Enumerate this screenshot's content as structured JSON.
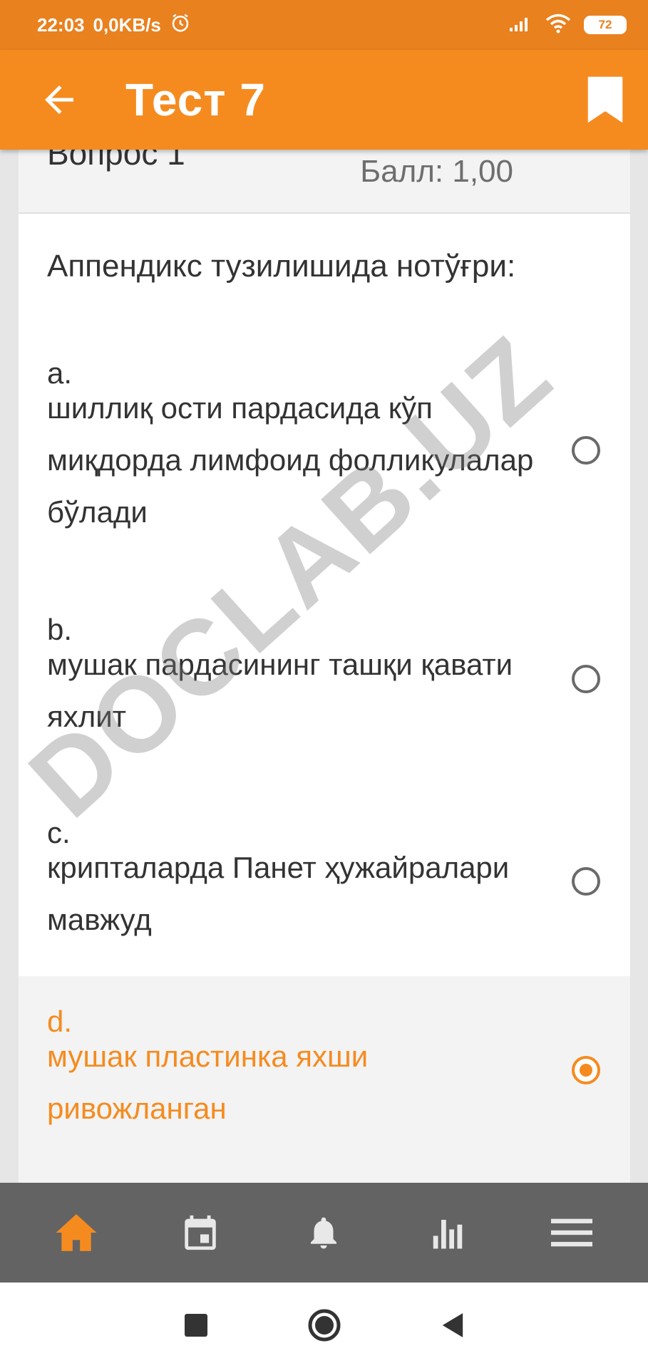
{
  "status_bar": {
    "time": "22:03",
    "speed": "0,0KB/s",
    "battery": "72"
  },
  "app_bar": {
    "title": "Тест 7"
  },
  "question": {
    "number_label": "Вопрос 1",
    "score_label": "Балл: 1,00",
    "text": "Аппендикс тузилишида нотўғри:"
  },
  "answers": [
    {
      "letter": "a.",
      "text": "шиллиқ ости пардасида кўп миқдорда лимфоид фолликулалар бўлади",
      "selected": false
    },
    {
      "letter": "b.",
      "text": "мушак пардасининг ташқи қавати яхлит",
      "selected": false
    },
    {
      "letter": "c.",
      "text": "крипталарда Панет ҳужайралари мавжуд",
      "selected": false
    },
    {
      "letter": "d.",
      "text": "мушак пластинка яхши ривожланган",
      "selected": true
    }
  ],
  "watermark": "DOCLAB.UZ",
  "colors": {
    "accent": "#f58b1f",
    "status_bar": "#e9811f",
    "bottom_nav": "#636363"
  }
}
